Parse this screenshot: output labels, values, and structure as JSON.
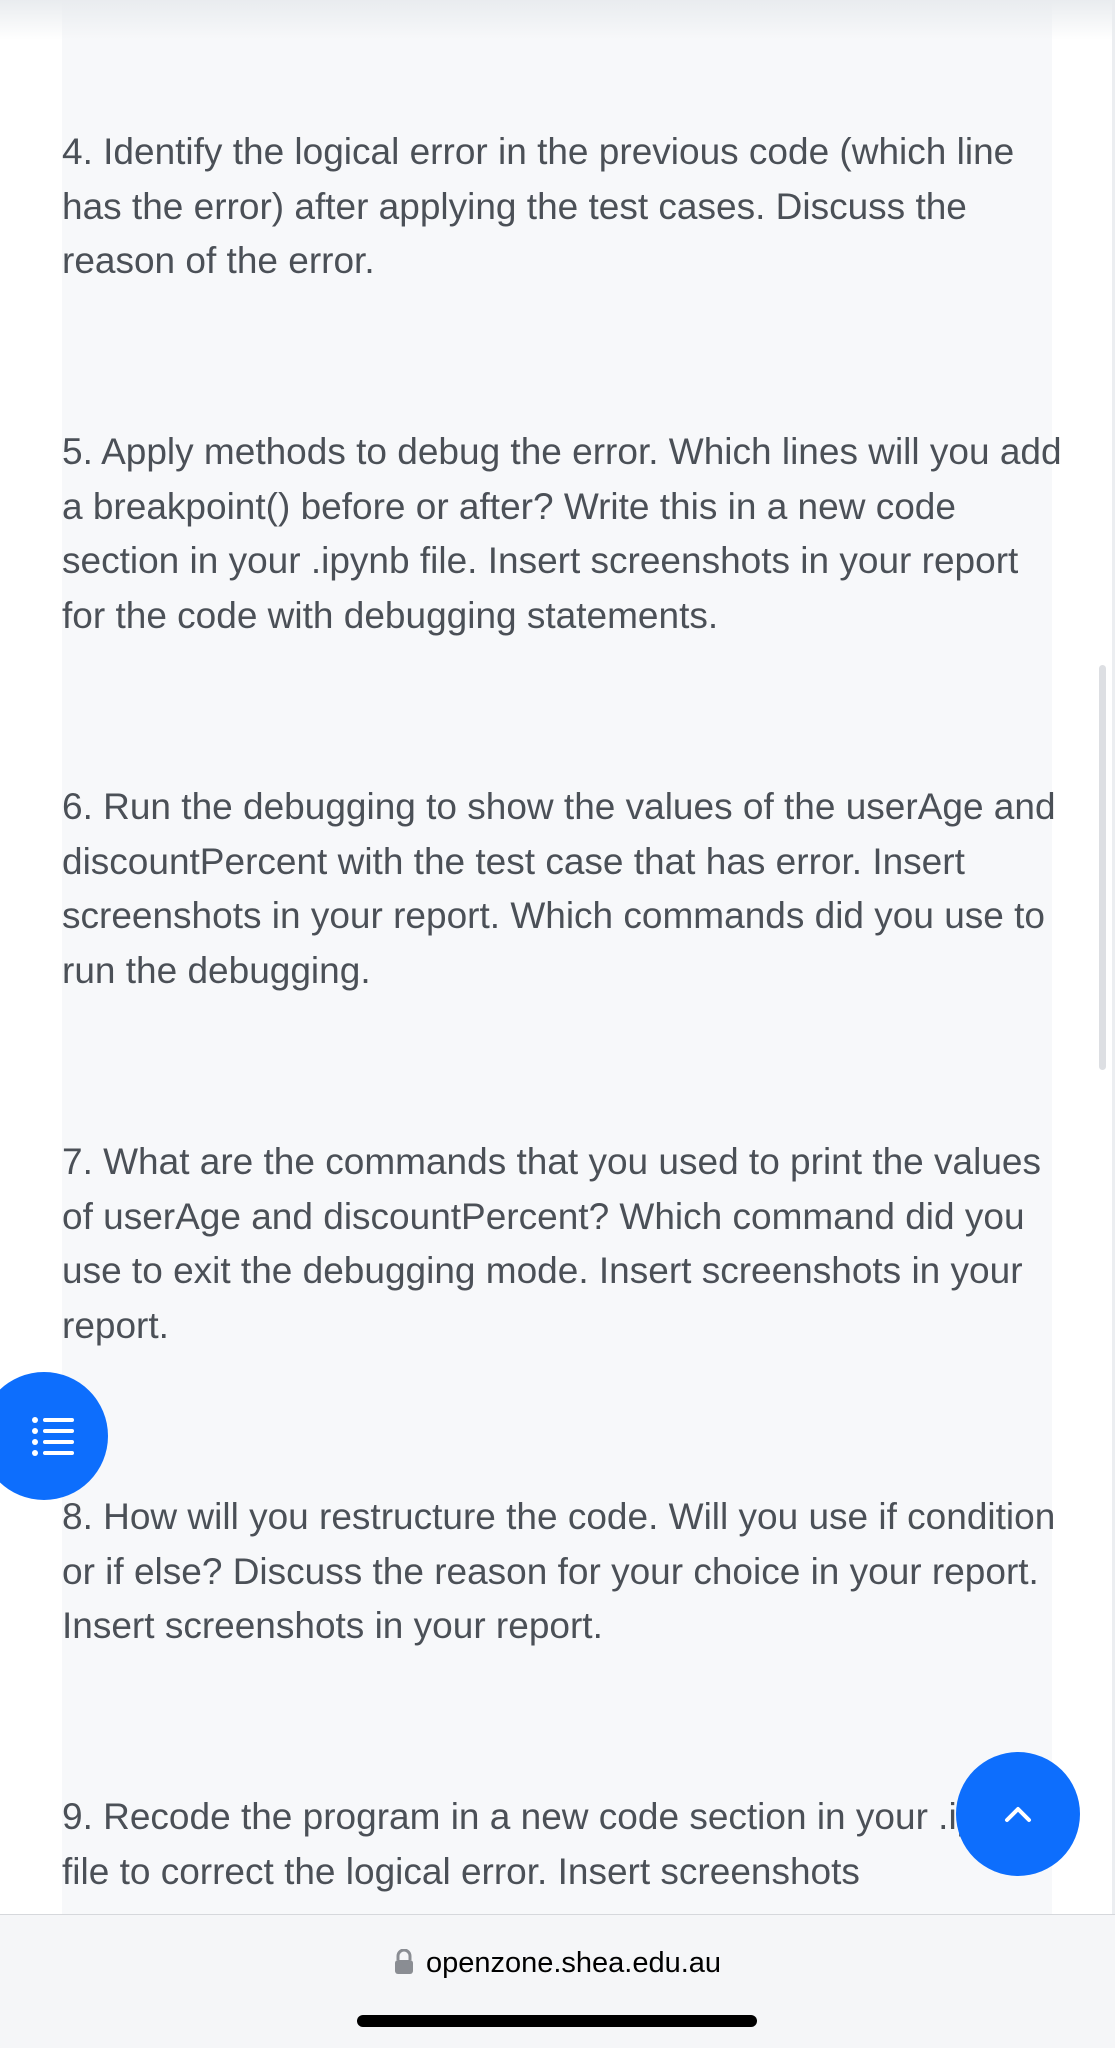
{
  "questions": [
    {
      "text": "4. Identify the logical error in the previous code (which line has the error) after applying the test cases. Discuss the reason of the error."
    },
    {
      "text": "5. Apply methods to debug the error. Which lines will you add a breakpoint() before or after?  Write this in a new code section in your .ipynb file. Insert screenshots in your report for the code with debugging statements."
    },
    {
      "text": "6. Run the debugging to show the values of the userAge and discountPercent with the test case that has error. Insert screenshots in your report. Which commands did you use to run the debugging."
    },
    {
      "text": "7. What are the commands that you used to print the values of userAge and discountPercent? Which command did you use to exit the debugging mode. Insert screenshots in your report."
    },
    {
      "text": "8. How will you restructure the code. Will you use if condition or if else? Discuss the reason for your choice in your report.  Insert screenshots in your report."
    },
    {
      "text": "9. Recode the program in a new code section in your .ipynb file to correct the logical error.  Insert screenshots"
    }
  ],
  "floating_buttons": {
    "toc_icon": "list-icon",
    "back_to_top_icon": "chevron-up-icon",
    "color": "#0d6efd"
  },
  "browser": {
    "url": "openzone.shea.edu.au",
    "lock_icon": "lock-icon"
  },
  "colors": {
    "text": "#4b5057",
    "panel_background": "#f7f8fa",
    "accent": "#0d6efd"
  }
}
